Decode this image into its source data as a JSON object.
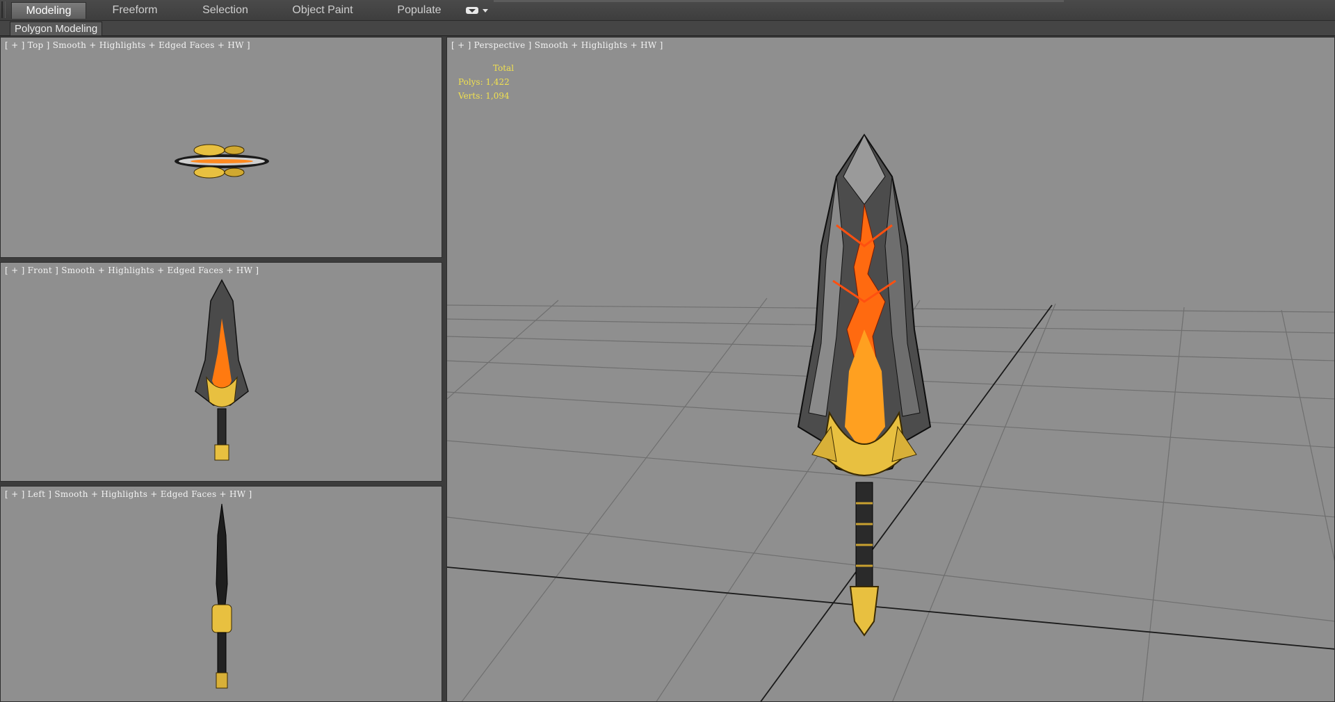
{
  "ribbon": {
    "tabs": [
      {
        "label": "Modeling",
        "active": true
      },
      {
        "label": "Freeform",
        "active": false
      },
      {
        "label": "Selection",
        "active": false
      },
      {
        "label": "Object Paint",
        "active": false
      },
      {
        "label": "Populate",
        "active": false
      }
    ],
    "panel_label": "Polygon Modeling"
  },
  "viewports": {
    "top": {
      "label": "[ + ] Top ] Smooth + Highlights + Edged Faces + HW ]"
    },
    "front": {
      "label": "[ + ] Front ] Smooth + Highlights + Edged Faces + HW ]"
    },
    "left": {
      "label": "[ + ] Left ] Smooth + Highlights + Edged Faces + HW ]"
    },
    "perspective": {
      "label": "[ + ] Perspective ] Smooth + Highlights + HW ]",
      "stats": {
        "header": "Total",
        "polys": "Polys: 1,422",
        "verts": "Verts: 1,094"
      }
    }
  },
  "colors": {
    "viewport_bg": "#8f8f8f",
    "stats_text": "#f0e050",
    "blade_steel": "#5a5a5a",
    "lava": "#ff7a10",
    "gold_guard": "#e8c040"
  },
  "icons": [
    "tab-options-icon",
    "sword-model"
  ]
}
